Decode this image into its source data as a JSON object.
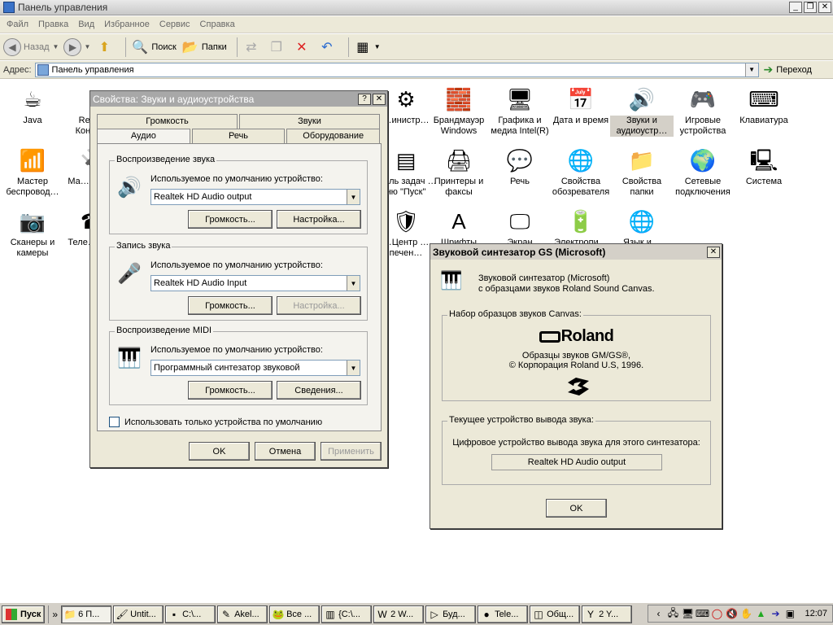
{
  "explorer": {
    "title": "Панель управления",
    "window_buttons": [
      "_",
      "❐",
      "✕"
    ],
    "menu": [
      "Файл",
      "Правка",
      "Вид",
      "Избранное",
      "Сервис",
      "Справка"
    ],
    "toolbar": {
      "back": "Назад",
      "search": "Поиск",
      "folders": "Папки"
    },
    "address": {
      "label": "Адрес:",
      "value": "Панель управления",
      "go": "Переход"
    }
  },
  "cp_items": [
    {
      "label": "Java",
      "icon": "☕"
    },
    {
      "label": "Realt… Конфи…",
      "icon": "♪"
    },
    {
      "label": "…инистр…",
      "icon": "⚙"
    },
    {
      "label": "Брандмауэр Windows",
      "icon": "🧱"
    },
    {
      "label": "Графика и медиа Intel(R)",
      "icon": "🖥"
    },
    {
      "label": "Дата и время",
      "icon": "📅"
    },
    {
      "label": "Звуки и аудиоустр…",
      "icon": "🔊"
    },
    {
      "label": "Игровые устройства",
      "icon": "🎮"
    },
    {
      "label": "Клавиатура",
      "icon": "⌨"
    },
    {
      "label": "Мастер беспровод…",
      "icon": "📶"
    },
    {
      "label": "Ма… наст…",
      "icon": "🔌"
    },
    {
      "label": "…ель задач …ню \"Пуск\"",
      "icon": "▤"
    },
    {
      "label": "Принтеры и факсы",
      "icon": "🖨"
    },
    {
      "label": "Речь",
      "icon": "💬"
    },
    {
      "label": "Свойства обозревателя",
      "icon": "🌐"
    },
    {
      "label": "Свойства папки",
      "icon": "📁"
    },
    {
      "label": "Сетевые подключения",
      "icon": "🌍"
    },
    {
      "label": "Система",
      "icon": "🖳"
    },
    {
      "label": "Сканеры и камеры",
      "icon": "📷"
    },
    {
      "label": "Теле… мо…",
      "icon": "☎"
    },
    {
      "label": "…Центр …печен…",
      "icon": "🛡"
    },
    {
      "label": "Шрифты",
      "icon": "A"
    },
    {
      "label": "Экран",
      "icon": "🖵"
    },
    {
      "label": "Электропи…",
      "icon": "🔋"
    },
    {
      "label": "Язык и…",
      "icon": "🌐"
    }
  ],
  "sound_dialog": {
    "title": "Свойства: Звуки и аудиоустройства",
    "help_btn": "?",
    "close_btn": "✕",
    "tabs_top": [
      "Громкость",
      "Звуки"
    ],
    "tabs_bottom": [
      "Аудио",
      "Речь",
      "Оборудование"
    ],
    "playback": {
      "label": "Воспроизведение звука",
      "default_text": "Используемое по умолчанию устройство:",
      "device": "Realtek HD Audio output",
      "volume_btn": "Громкость...",
      "settings_btn": "Настройка..."
    },
    "record": {
      "label": "Запись звука",
      "default_text": "Используемое по умолчанию устройство:",
      "device": "Realtek HD Audio Input",
      "volume_btn": "Громкость...",
      "settings_btn": "Настройка..."
    },
    "midi": {
      "label": "Воспроизведение MIDI",
      "default_text": "Используемое по умолчанию устройство:",
      "device": "Программный синтезатор звуковой",
      "volume_btn": "Громкость...",
      "about_btn": "Сведения..."
    },
    "only_default": "Использовать только устройства по умолчанию",
    "ok": "OK",
    "cancel": "Отмена",
    "apply": "Применить"
  },
  "gs_dialog": {
    "title": "Звуковой синтезатор GS (Microsoft)",
    "close_btn": "✕",
    "desc_line1": "Звуковой синтезатор (Microsoft)",
    "desc_line2": "с образцами звуков Roland Sound Canvas.",
    "canvas_group": "Набор образцов звуков Canvas:",
    "roland_logo": "Roland",
    "samples_line1": "Образцы звуков GM/GS®,",
    "samples_line2": "© Корпорация Roland U.S, 1996.",
    "output_group": "Текущее устройство вывода звука:",
    "output_desc": "Цифровое устройство вывода звука для этого синтезатора:",
    "output_device": "Realtek HD Audio output",
    "ok": "OK"
  },
  "taskbar": {
    "start": "Пуск",
    "tasks": [
      {
        "label": "6 П...",
        "icon": "📁",
        "pressed": true,
        "w": 62
      },
      {
        "label": "Untit...",
        "icon": "🖌",
        "pressed": false,
        "w": 62
      },
      {
        "label": "C:\\...",
        "icon": "▪",
        "pressed": false,
        "w": 62
      },
      {
        "label": "Akel...",
        "icon": "✎",
        "pressed": false,
        "w": 62
      },
      {
        "label": "Все ...",
        "icon": "🐸",
        "pressed": false,
        "w": 62
      },
      {
        "label": "{C:\\...",
        "icon": "▥",
        "pressed": false,
        "w": 62
      },
      {
        "label": "2 W...",
        "icon": "W",
        "pressed": false,
        "w": 62
      },
      {
        "label": "Буд...",
        "icon": "▷",
        "pressed": false,
        "w": 62
      },
      {
        "label": "Tele...",
        "icon": "●",
        "pressed": false,
        "w": 62
      },
      {
        "label": "Общ...",
        "icon": "◫",
        "pressed": false,
        "w": 62
      },
      {
        "label": "2 Y...",
        "icon": "Y",
        "pressed": false,
        "w": 62
      }
    ],
    "clock": "12:07"
  }
}
